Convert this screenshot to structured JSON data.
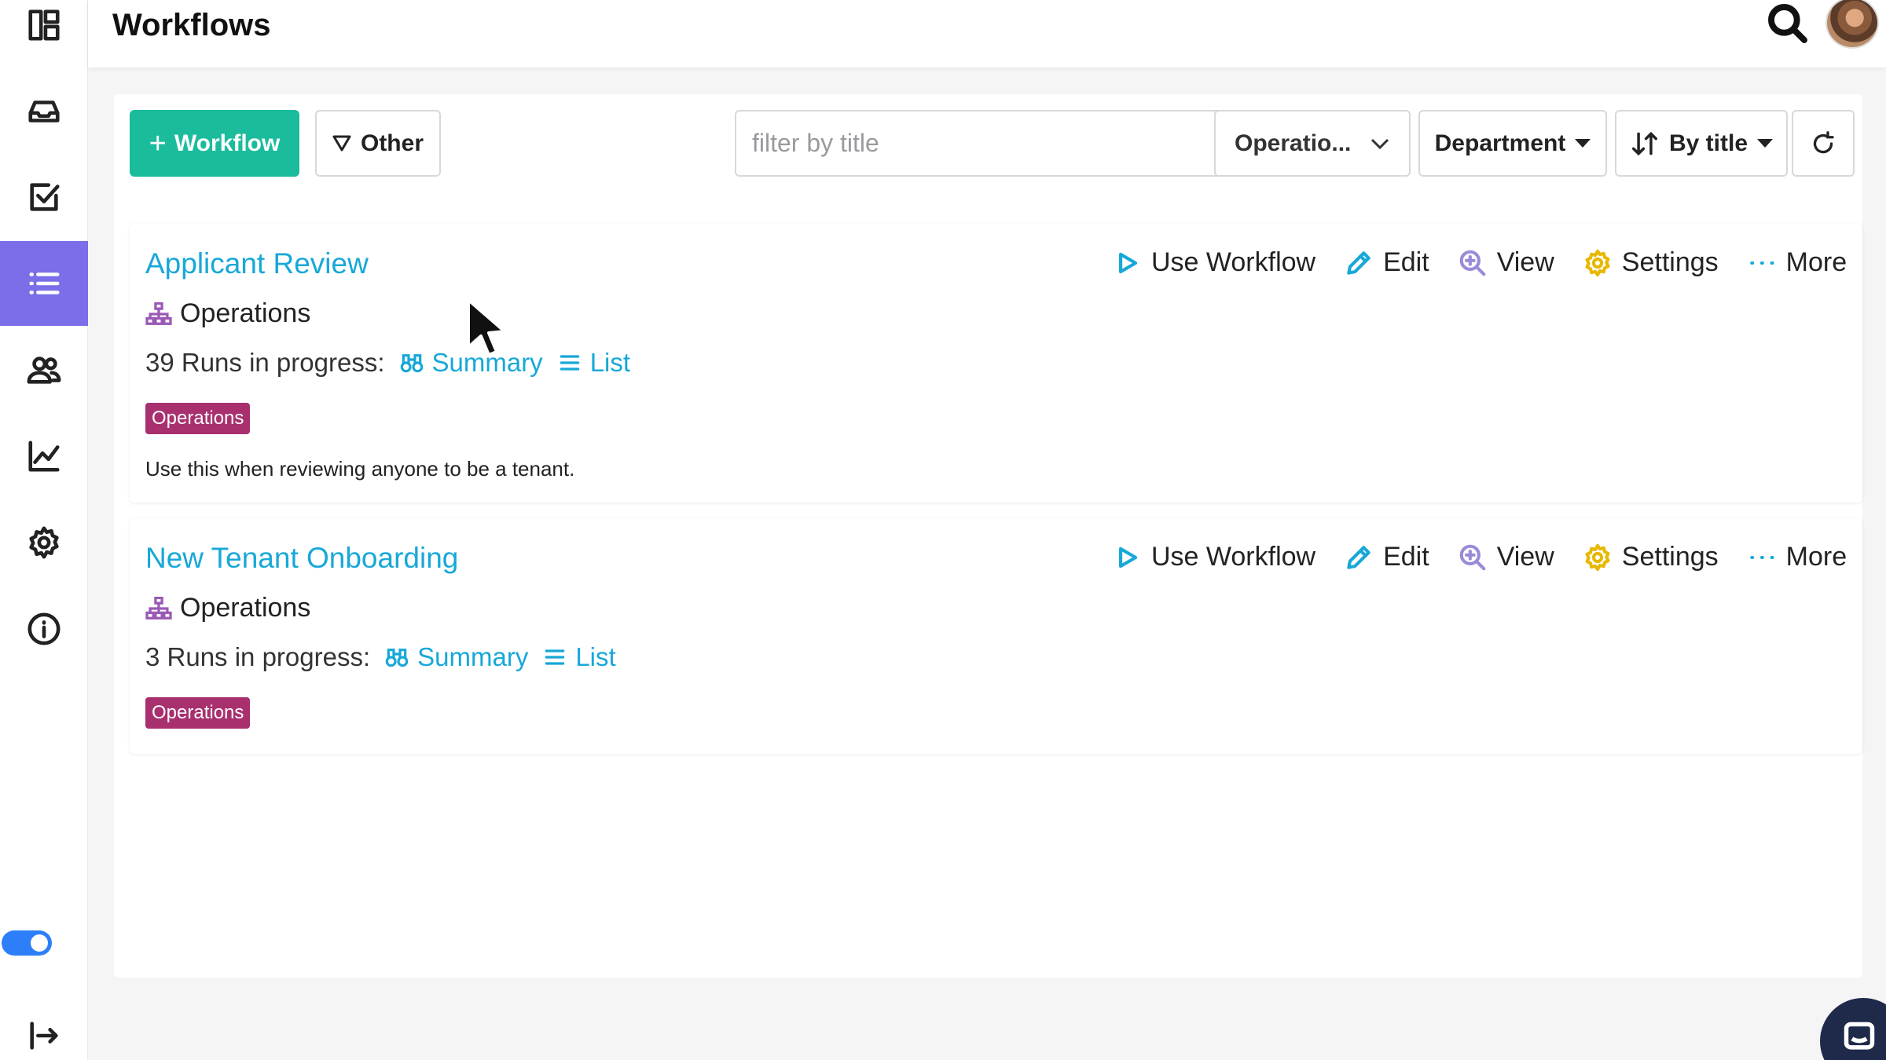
{
  "header": {
    "title": "Workflows"
  },
  "sidebar": {
    "items": [
      {
        "icon": "dashboard-icon"
      },
      {
        "icon": "inbox-icon"
      },
      {
        "icon": "task-check-icon"
      },
      {
        "icon": "list-icon",
        "active": true
      },
      {
        "icon": "users-icon"
      },
      {
        "icon": "chart-line-icon"
      },
      {
        "icon": "gear-icon"
      },
      {
        "icon": "info-icon"
      }
    ],
    "toggle_on": true,
    "collapse_icon": "collapse-arrow-icon"
  },
  "toolbar": {
    "add_label": "Workflow",
    "other_label": "Other",
    "filter_placeholder": "filter by title",
    "filter_value": "",
    "operations_select": "Operatio...",
    "department_label": "Department",
    "sort_label": "By title"
  },
  "workflows": [
    {
      "title": "Applicant Review",
      "department": "Operations",
      "runs_text": "39 Runs in progress:",
      "summary_label": "Summary",
      "list_label": "List",
      "tag": "Operations",
      "description": "Use this when reviewing anyone to be a tenant."
    },
    {
      "title": "New Tenant Onboarding",
      "department": "Operations",
      "runs_text": "3 Runs in progress:",
      "summary_label": "Summary",
      "list_label": "List",
      "tag": "Operations",
      "description": ""
    }
  ],
  "actions": {
    "use": "Use Workflow",
    "edit": "Edit",
    "view": "View",
    "settings": "Settings",
    "more": "More"
  },
  "colors": {
    "accent_teal": "#1abc9c",
    "link_blue": "#17a8d8",
    "active_sidebar": "#7b6ee8",
    "tag_magenta": "#a8306f",
    "settings_yellow": "#e8b800",
    "view_purple": "#9b8ad8"
  }
}
